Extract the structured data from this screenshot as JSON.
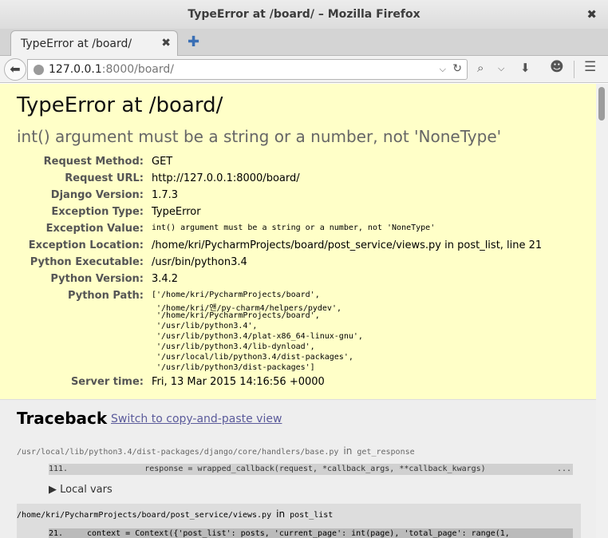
{
  "window": {
    "title": "TypeError at /board/ – Mozilla Firefox",
    "close_glyph": "✖"
  },
  "tab": {
    "label": "TypeError at /board/",
    "close_glyph": "✖",
    "new_tab_glyph": "✚"
  },
  "nav": {
    "back_glyph": "⬅",
    "url_host": "127.0.0.1",
    "url_rest": ":8000/board/",
    "dropdown_glyph": "⌵",
    "reload_glyph": "↻",
    "search_glyph": "⌕",
    "search_dd_glyph": "⌵",
    "download_glyph": "⬇",
    "chat_glyph": "☻",
    "menu_glyph": "☰"
  },
  "error": {
    "title": "TypeError at /board/",
    "message": "int() argument must be a string or a number, not 'NoneType'",
    "meta": [
      {
        "label": "Request Method:",
        "value": "GET"
      },
      {
        "label": "Request URL:",
        "value": "http://127.0.0.1:8000/board/"
      },
      {
        "label": "Django Version:",
        "value": "1.7.3"
      },
      {
        "label": "Exception Type:",
        "value": "TypeError"
      },
      {
        "label": "Exception Value:",
        "value": "int() argument must be a string or a number, not 'NoneType'"
      },
      {
        "label": "Exception Location:",
        "value": "/home/kri/PycharmProjects/board/post_service/views.py in post_list, line 21"
      },
      {
        "label": "Python Executable:",
        "value": "/usr/bin/python3.4"
      },
      {
        "label": "Python Version:",
        "value": "3.4.2"
      },
      {
        "label": "Python Path:",
        "value": ""
      },
      {
        "label": "Server time:",
        "value": "Fri, 13 Mar 2015 14:16:56 +0000"
      }
    ],
    "python_path": [
      "['/home/kri/PycharmProjects/board',",
      " '/home/kri/앤/py-charm4/helpers/pydev',",
      " '/home/kri/PycharmProjects/board',",
      " '/usr/lib/python3.4',",
      " '/usr/lib/python3.4/plat-x86_64-linux-gnu',",
      " '/usr/lib/python3.4/lib-dynload',",
      " '/usr/local/lib/python3.4/dist-packages',",
      " '/usr/lib/python3/dist-packages']"
    ]
  },
  "traceback": {
    "title": "Traceback",
    "switch_link": "Switch to copy-and-paste view",
    "in_word": "in",
    "frames": [
      {
        "file": "/usr/local/lib/python3.4/dist-packages/django/core/handlers/base.py",
        "function": "get_response",
        "line_no": "111.",
        "code": "            response = wrapped_callback(request, *callback_args, **callback_kwargs)",
        "ellipsis": "...",
        "local_vars": "▶ Local vars"
      },
      {
        "file": "/home/kri/PycharmProjects/board/post_service/views.py",
        "function": "post_list",
        "line_no": "21.",
        "code": "context = Context({'post_list': posts, 'current_page': int(page), 'total_page': range(1,"
      }
    ]
  }
}
